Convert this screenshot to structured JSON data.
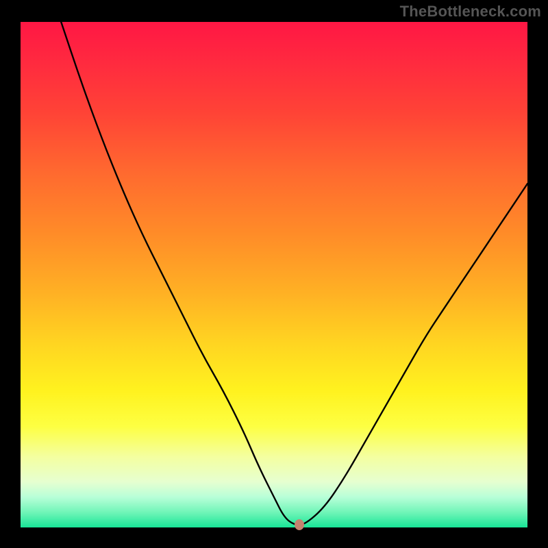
{
  "watermark": "TheBottleneck.com",
  "chart_data": {
    "type": "line",
    "title": "",
    "xlabel": "",
    "ylabel": "",
    "xlim": [
      0,
      100
    ],
    "ylim": [
      0,
      100
    ],
    "grid": false,
    "legend": false,
    "series": [
      {
        "name": "curve",
        "x": [
          8,
          12,
          16,
          20,
          24,
          28,
          32,
          36,
          40,
          44,
          47,
          50,
          52,
          54,
          56,
          60,
          64,
          68,
          72,
          76,
          80,
          84,
          88,
          92,
          96,
          100
        ],
        "y": [
          100,
          88,
          77,
          67,
          58,
          50,
          42,
          34,
          27,
          19,
          12,
          6,
          2,
          0.5,
          0.5,
          4,
          10,
          17,
          24,
          31,
          38,
          44,
          50,
          56,
          62,
          68
        ]
      }
    ],
    "annotations": [
      {
        "name": "best-point",
        "x": 55,
        "y": 0.5
      }
    ],
    "background_gradient": {
      "top": "#ff1744",
      "middle": "#fff21f",
      "bottom": "#18e597"
    }
  }
}
